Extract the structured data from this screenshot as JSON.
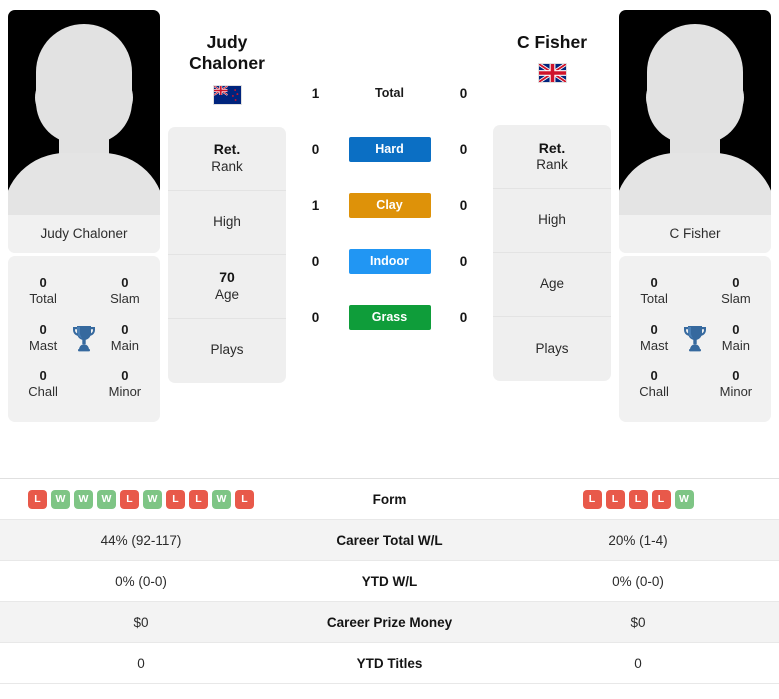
{
  "players": {
    "left": {
      "name_line1": "Judy",
      "name_line2": "Chaloner",
      "photo_name": "Judy Chaloner",
      "flag": "new-zealand-flag",
      "flag_alt": "New Zealand",
      "rank_rows": [
        {
          "value": "Ret.",
          "label": "Rank"
        },
        {
          "value": "",
          "label": "High"
        },
        {
          "value": "70",
          "label": "Age"
        },
        {
          "value": "",
          "label": "Plays"
        }
      ],
      "honours": [
        {
          "value": "0",
          "label": "Total"
        },
        {
          "value": "0",
          "label": "Slam"
        },
        {
          "value": "0",
          "label": "Mast"
        },
        {
          "value": "0",
          "label": "Main"
        },
        {
          "value": "0",
          "label": "Chall"
        },
        {
          "value": "0",
          "label": "Minor"
        }
      ],
      "form": [
        "L",
        "W",
        "W",
        "W",
        "L",
        "W",
        "L",
        "L",
        "W",
        "L"
      ]
    },
    "right": {
      "name_line1": "C Fisher",
      "name_line2": "",
      "photo_name": "C Fisher",
      "flag": "united-kingdom-flag",
      "flag_alt": "United Kingdom",
      "rank_rows": [
        {
          "value": "Ret.",
          "label": "Rank"
        },
        {
          "value": "",
          "label": "High"
        },
        {
          "value": "",
          "label": "Age"
        },
        {
          "value": "",
          "label": "Plays"
        }
      ],
      "honours": [
        {
          "value": "0",
          "label": "Total"
        },
        {
          "value": "0",
          "label": "Slam"
        },
        {
          "value": "0",
          "label": "Mast"
        },
        {
          "value": "0",
          "label": "Main"
        },
        {
          "value": "0",
          "label": "Chall"
        },
        {
          "value": "0",
          "label": "Minor"
        }
      ],
      "form": [
        "L",
        "L",
        "L",
        "L",
        "W"
      ]
    }
  },
  "surfaces": [
    {
      "label": "Total",
      "left": "1",
      "right": "0",
      "color": "",
      "chip": false
    },
    {
      "label": "Hard",
      "left": "0",
      "right": "0",
      "color": "#0b6fc4",
      "chip": true
    },
    {
      "label": "Clay",
      "left": "1",
      "right": "0",
      "color": "#de9209",
      "chip": true
    },
    {
      "label": "Indoor",
      "left": "0",
      "right": "0",
      "color": "#2196f3",
      "chip": true
    },
    {
      "label": "Grass",
      "left": "0",
      "right": "0",
      "color": "#0f9d3a",
      "chip": true
    }
  ],
  "stats_rows": [
    {
      "label": "Form",
      "left": "",
      "right": "",
      "type": "form"
    },
    {
      "label": "Career Total W/L",
      "left": "44% (92-117)",
      "right": "20% (1-4)",
      "type": "text"
    },
    {
      "label": "YTD W/L",
      "left": "0% (0-0)",
      "right": "0% (0-0)",
      "type": "text"
    },
    {
      "label": "Career Prize Money",
      "left": "$0",
      "right": "$0",
      "type": "text"
    },
    {
      "label": "YTD Titles",
      "left": "0",
      "right": "0",
      "type": "text"
    }
  ],
  "colors": {
    "hard": "#0b6fc4",
    "clay": "#de9209",
    "indoor": "#2196f3",
    "grass": "#0f9d3a",
    "win_badge": "#7ec585",
    "loss_badge": "#e8594a",
    "trophy": "#36699e"
  },
  "icons": {
    "trophy": "trophy-icon"
  }
}
